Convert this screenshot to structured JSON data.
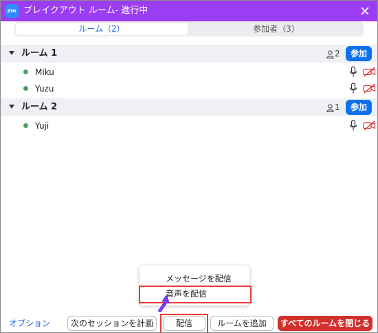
{
  "window": {
    "app_icon_text": "zm",
    "title": "ブレイクアウト ルーム- 進行中"
  },
  "tabs": [
    {
      "label": "ルーム（2）",
      "active": true
    },
    {
      "label": "参加者（3）",
      "active": false
    }
  ],
  "rooms": [
    {
      "name": "ルーム 1",
      "count": "2",
      "join_label": "参加",
      "members": [
        {
          "name": "Miku"
        },
        {
          "name": "Yuzu"
        }
      ]
    },
    {
      "name": "ルーム 2",
      "count": "1",
      "join_label": "参加",
      "members": [
        {
          "name": "Yuji"
        }
      ]
    }
  ],
  "popup_menu": {
    "items": [
      "メッセージを配信",
      "音声を配信"
    ]
  },
  "footer": {
    "options_label": "オプション",
    "schedule_label": "次のセッションを計画",
    "broadcast_label": "配信",
    "add_room_label": "ルームを追加",
    "close_all_label": "すべてのルームを閉じる"
  },
  "colors": {
    "titlebar": "#9b3df2",
    "join_button": "#0e71eb",
    "close_all_button": "#d0312d",
    "highlight": "#e63b3b",
    "active_dot": "#4fa060",
    "cam_off": "#d8322d"
  }
}
